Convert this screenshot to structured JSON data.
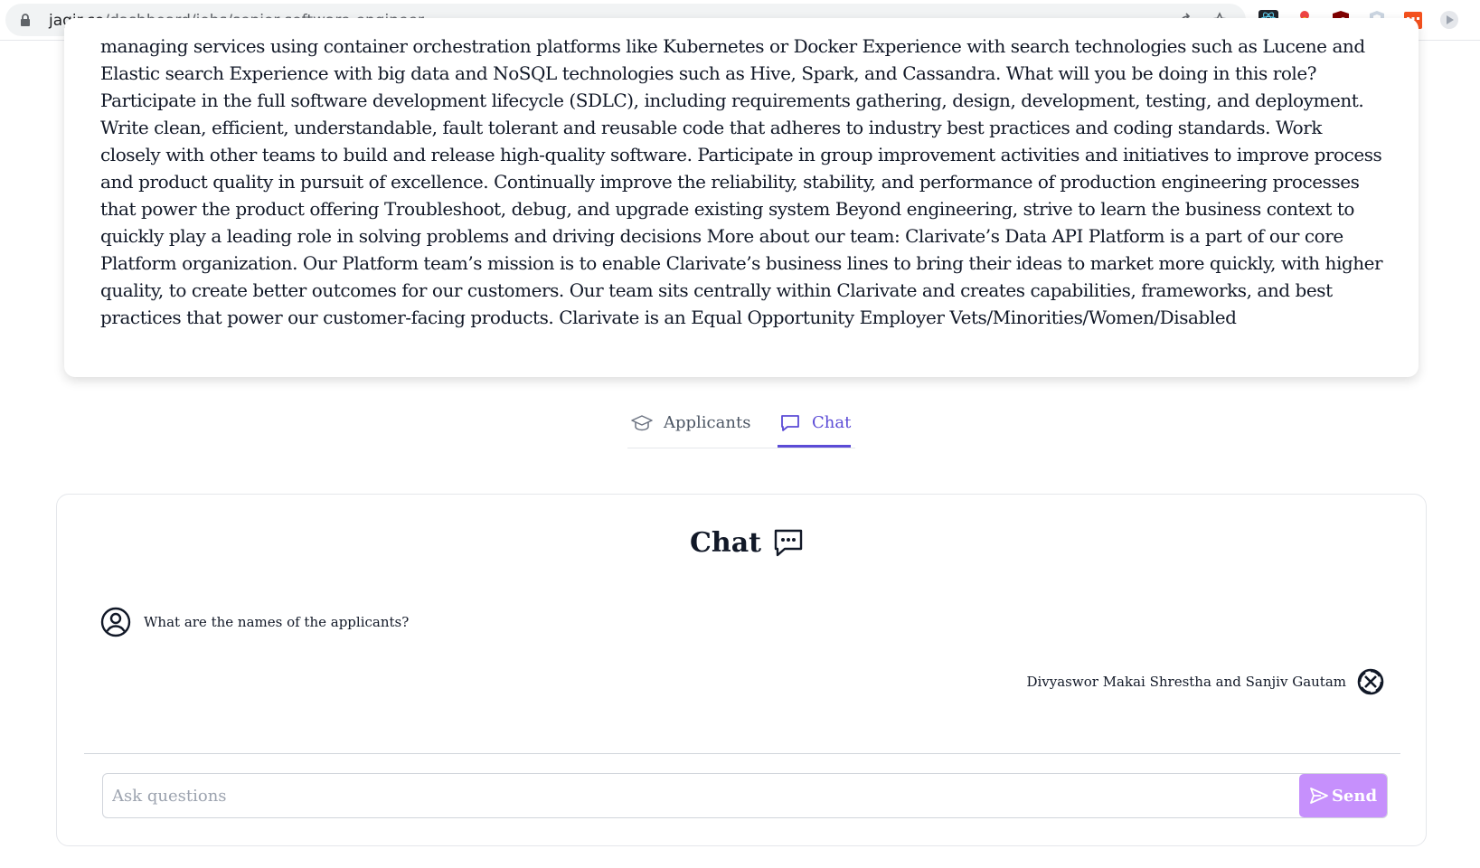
{
  "browser": {
    "url_host": "jagir.co",
    "url_path": "/dashboard/jobs/senior-software-engineer"
  },
  "job": {
    "description": "managing services using container orchestration platforms like Kubernetes or Docker Experience with search technologies such as Lucene and Elastic search Experience with big data and NoSQL technologies such as Hive, Spark, and Cassandra. What will you be doing in this role? Participate in the full software development lifecycle (SDLC), including requirements gathering, design, development, testing, and deployment. Write clean, efficient, understandable, fault tolerant and reusable code that adheres to industry best practices and coding standards. Work closely with other teams to build and release high-quality software. Participate in group improvement activities and initiatives to improve process and product quality in pursuit of excellence. Continually improve the reliability, stability, and performance of production engineering processes that power the product offering Troubleshoot, debug, and upgrade existing system Beyond engineering, strive to learn the business context to quickly play a leading role in solving problems and driving decisions More about our team: Clarivate’s Data API Platform is a part of our core Platform organization. Our Platform team’s mission is to enable Clarivate’s business lines to bring their ideas to market more quickly, with higher quality, to create better outcomes for our customers. Our team sits centrally within Clarivate and creates capabilities, frameworks, and best practices that power our customer-facing products. Clarivate is an Equal Opportunity Employer Vets/Minorities/Women/Disabled"
  },
  "tabs": {
    "applicants_label": "Applicants",
    "chat_label": "Chat",
    "active": "Chat"
  },
  "chat": {
    "title": "Chat",
    "user_message": "What are the names of the applicants?",
    "bot_message": "Divyaswor Makai Shrestha and Sanjiv Gautam",
    "input_placeholder": "Ask questions",
    "input_value": "",
    "send_label": "Send"
  },
  "colors": {
    "accent": "#5b4bd6",
    "send_button": "#c084fc"
  }
}
